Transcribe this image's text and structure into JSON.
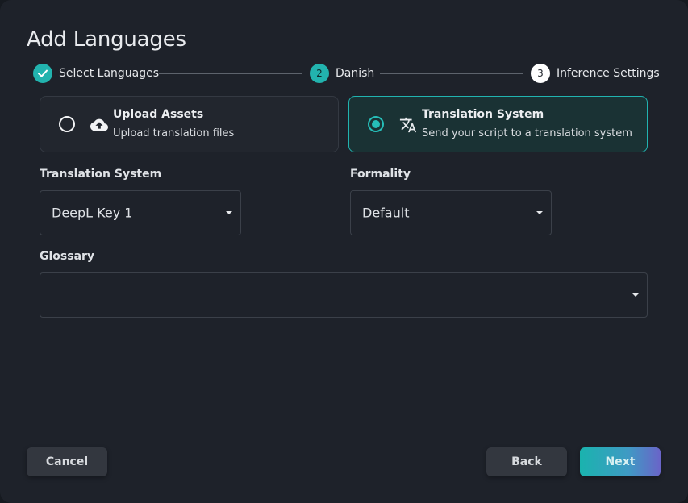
{
  "dialog": {
    "title": "Add Languages"
  },
  "stepper": {
    "steps": [
      {
        "number": "",
        "label": "Select Languages",
        "state": "completed"
      },
      {
        "number": "2",
        "label": "Danish",
        "state": "active"
      },
      {
        "number": "3",
        "label": "Inference Settings",
        "state": "upcoming"
      }
    ]
  },
  "options": {
    "upload": {
      "title": "Upload Assets",
      "subtitle": "Upload translation files",
      "selected": false,
      "icon": "cloud-upload-icon"
    },
    "translation": {
      "title": "Translation System",
      "subtitle": "Send your script to a translation system",
      "selected": true,
      "icon": "translate-icon"
    }
  },
  "fields": {
    "translation_system": {
      "label": "Translation System",
      "value": "DeepL Key 1"
    },
    "formality": {
      "label": "Formality",
      "value": "Default"
    },
    "glossary": {
      "label": "Glossary",
      "value": ""
    }
  },
  "buttons": {
    "cancel": "Cancel",
    "back": "Back",
    "next": "Next"
  },
  "colors": {
    "accent": "#21b3b0",
    "background": "#1e222a",
    "selected_card": "#1a3234"
  }
}
